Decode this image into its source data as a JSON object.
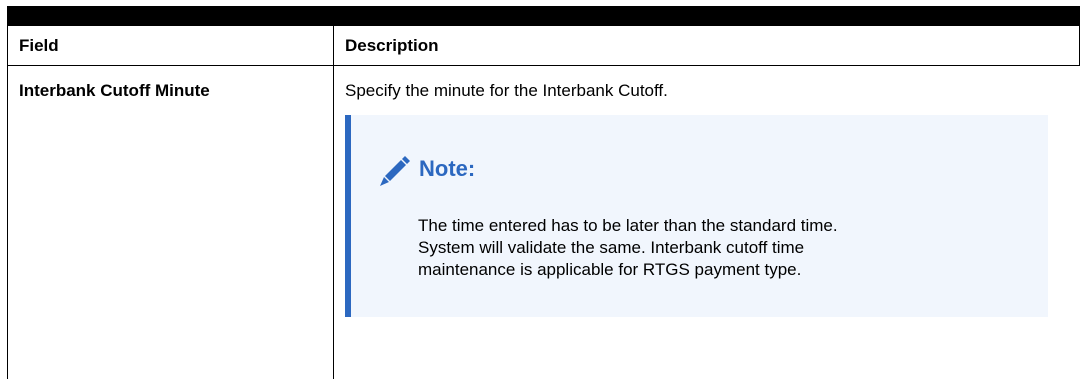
{
  "table": {
    "headers": {
      "field": "Field",
      "description": "Description"
    },
    "rows": [
      {
        "field": "Interbank Cutoff Minute",
        "description": "Specify the minute for the Interbank Cutoff.",
        "note": {
          "icon": "pencil-icon",
          "title": "Note:",
          "lines": [
            "The time entered has to be later than the standard time.",
            "System will validate the same. Interbank cutoff time",
            "maintenance is applicable for RTGS payment type."
          ]
        }
      }
    ]
  },
  "colors": {
    "note_accent": "#2c68c0",
    "note_background": "#f1f6fd",
    "rule": "#000000"
  }
}
